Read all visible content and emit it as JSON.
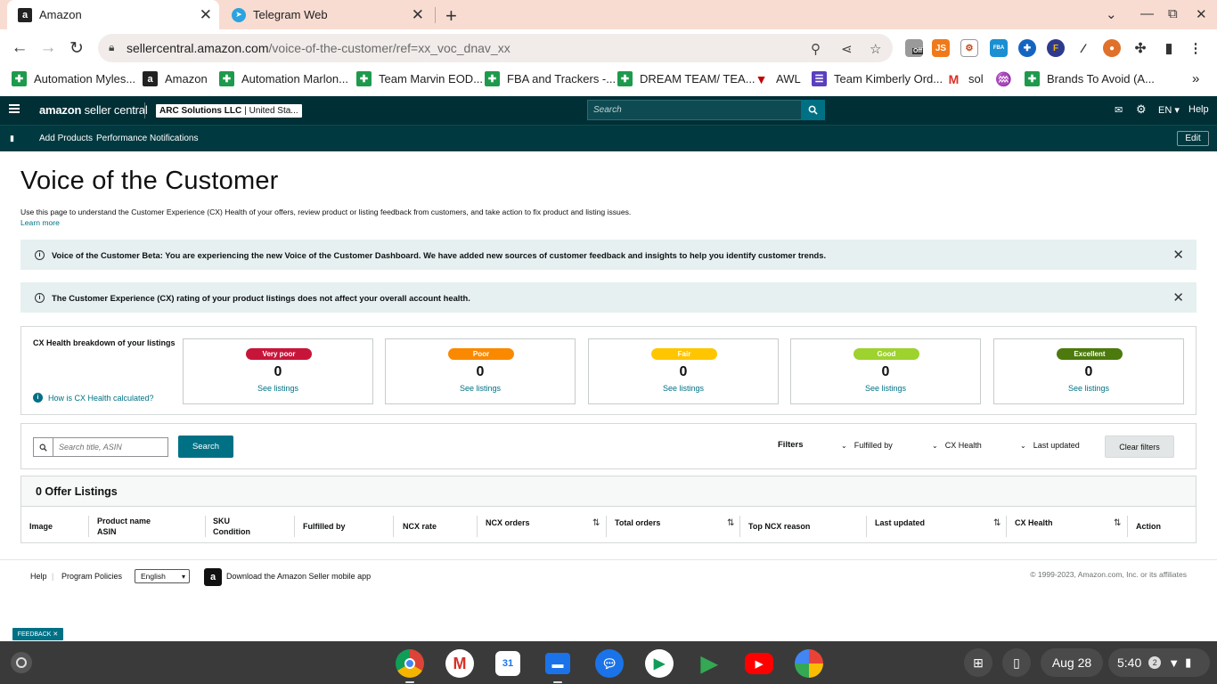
{
  "browser": {
    "tabs": [
      {
        "title": "Amazon",
        "active": true
      },
      {
        "title": "Telegram Web",
        "active": false
      }
    ],
    "url_host": "sellercentral.amazon.com",
    "url_path": "/voice-of-the-customer/ref=xx_voc_dnav_xx",
    "ext_off_label": "Off",
    "ext_js_label": "JS",
    "ext_fba_label": "FBA",
    "bookmarks": [
      {
        "label": "Automation Myles...",
        "icon": "sheets-icon"
      },
      {
        "label": "Amazon",
        "icon": "amazon-icon"
      },
      {
        "label": "Automation Marlon...",
        "icon": "sheets-icon"
      },
      {
        "label": "Team Marvin EOD...",
        "icon": "sheets-icon"
      },
      {
        "label": "FBA and Trackers -...",
        "icon": "sheets-icon"
      },
      {
        "label": "DREAM TEAM/ TEA...",
        "icon": "sheets-icon"
      },
      {
        "label": "AWL",
        "icon": "awl-icon"
      },
      {
        "label": "Team Kimberly Ord...",
        "icon": "forms-icon"
      },
      {
        "label": "sol",
        "icon": "gmail-icon"
      },
      {
        "label": "",
        "icon": "vine-icon"
      },
      {
        "label": "Brands To Avoid (A...",
        "icon": "sheets-icon"
      }
    ]
  },
  "header": {
    "logo_main": "amazon",
    "logo_sub": "seller central",
    "account_name": "ARC Solutions LLC",
    "account_region": "| United Sta...",
    "search_placeholder": "Search",
    "language": "EN",
    "help": "Help",
    "sub_items": [
      "Add Products",
      "Performance Notifications"
    ],
    "edit": "Edit"
  },
  "page": {
    "title": "Voice of the Customer",
    "description": "Use this page to understand the Customer Experience (CX) Health of your offers, review product or listing feedback from customers, and take action to fix product and listing issues.",
    "learn_more": "Learn more",
    "alert1": "Voice of the Customer Beta: You are experiencing the new Voice of the Customer Dashboard. We have added new sources of customer feedback and insights to help you identify customer trends.",
    "alert2": "The Customer Experience (CX) rating of your product listings does not affect your overall account health.",
    "cx_title": "CX Health breakdown of your listings",
    "cx_how": "How is CX Health calculated?",
    "cx_cards": [
      {
        "label": "Very poor",
        "count": "0",
        "link": "See listings",
        "color": "#c7153a"
      },
      {
        "label": "Poor",
        "count": "0",
        "link": "See listings",
        "color": "#fa8900"
      },
      {
        "label": "Fair",
        "count": "0",
        "link": "See listings",
        "color": "#ffc600"
      },
      {
        "label": "Good",
        "count": "0",
        "link": "See listings",
        "color": "#9ed22e"
      },
      {
        "label": "Excellent",
        "count": "0",
        "link": "See listings",
        "color": "#4c7a0c"
      }
    ],
    "search_placeholder": "Search title, ASIN",
    "search_button": "Search",
    "filters_label": "Filters",
    "filter_dropdowns": [
      "Fulfilled by",
      "CX Health",
      "Last updated"
    ],
    "clear_filters": "Clear filters",
    "listings_title": "0 Offer Listings",
    "columns": [
      {
        "l1": "Image",
        "l2": ""
      },
      {
        "l1": "Product name",
        "l2": "ASIN"
      },
      {
        "l1": "SKU",
        "l2": "Condition"
      },
      {
        "l1": "Fulfilled by",
        "l2": ""
      },
      {
        "l1": "NCX rate",
        "l2": ""
      },
      {
        "l1": "NCX orders",
        "l2": ""
      },
      {
        "l1": "Total orders",
        "l2": ""
      },
      {
        "l1": "Top NCX reason",
        "l2": ""
      },
      {
        "l1": "Last updated",
        "l2": ""
      },
      {
        "l1": "CX Health",
        "l2": ""
      },
      {
        "l1": "Action",
        "l2": ""
      }
    ]
  },
  "footer": {
    "help": "Help",
    "policies": "Program Policies",
    "language": "English",
    "app_text": "Download the Amazon Seller mobile app",
    "copyright": "© 1999-2023, Amazon.com, Inc. or its affiliates",
    "feedback": "FEEDBACK"
  },
  "shelf": {
    "date": "Aug 28",
    "time": "5:40",
    "notification_count": "2",
    "apps": [
      "chrome-icon",
      "gmail-icon",
      "calendar-icon",
      "files-icon",
      "messages-icon",
      "meet-icon",
      "play-store-icon",
      "youtube-icon",
      "photos-icon"
    ],
    "calendar_day": "31"
  }
}
